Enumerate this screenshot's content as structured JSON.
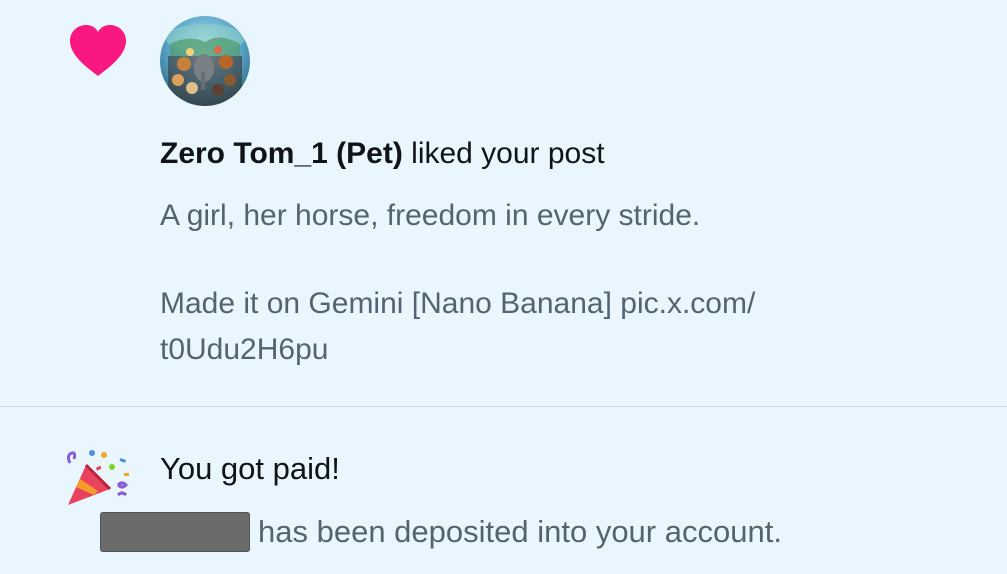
{
  "notifications": {
    "like": {
      "icon": "heart-icon",
      "avatar": "avatar-animals-globe",
      "user_name": "Zero Tom_1 (Pet)",
      "action_text": " liked your post",
      "post_line1": "A girl, her horse, freedom in every stride.",
      "post_line2": "Made it on Gemini [Nano Banana] pic.x.com/",
      "post_line3": "t0Udu2H6pu"
    },
    "payment": {
      "icon": "party-popper-icon",
      "title": "You got paid!",
      "amount_redacted": true,
      "deposit_text": "has been deposited into your account."
    }
  },
  "colors": {
    "background": "#eaf6fd",
    "heart": "#f91880",
    "text_primary": "#0f1419",
    "text_secondary": "#536471",
    "divider": "#cfd9de"
  }
}
